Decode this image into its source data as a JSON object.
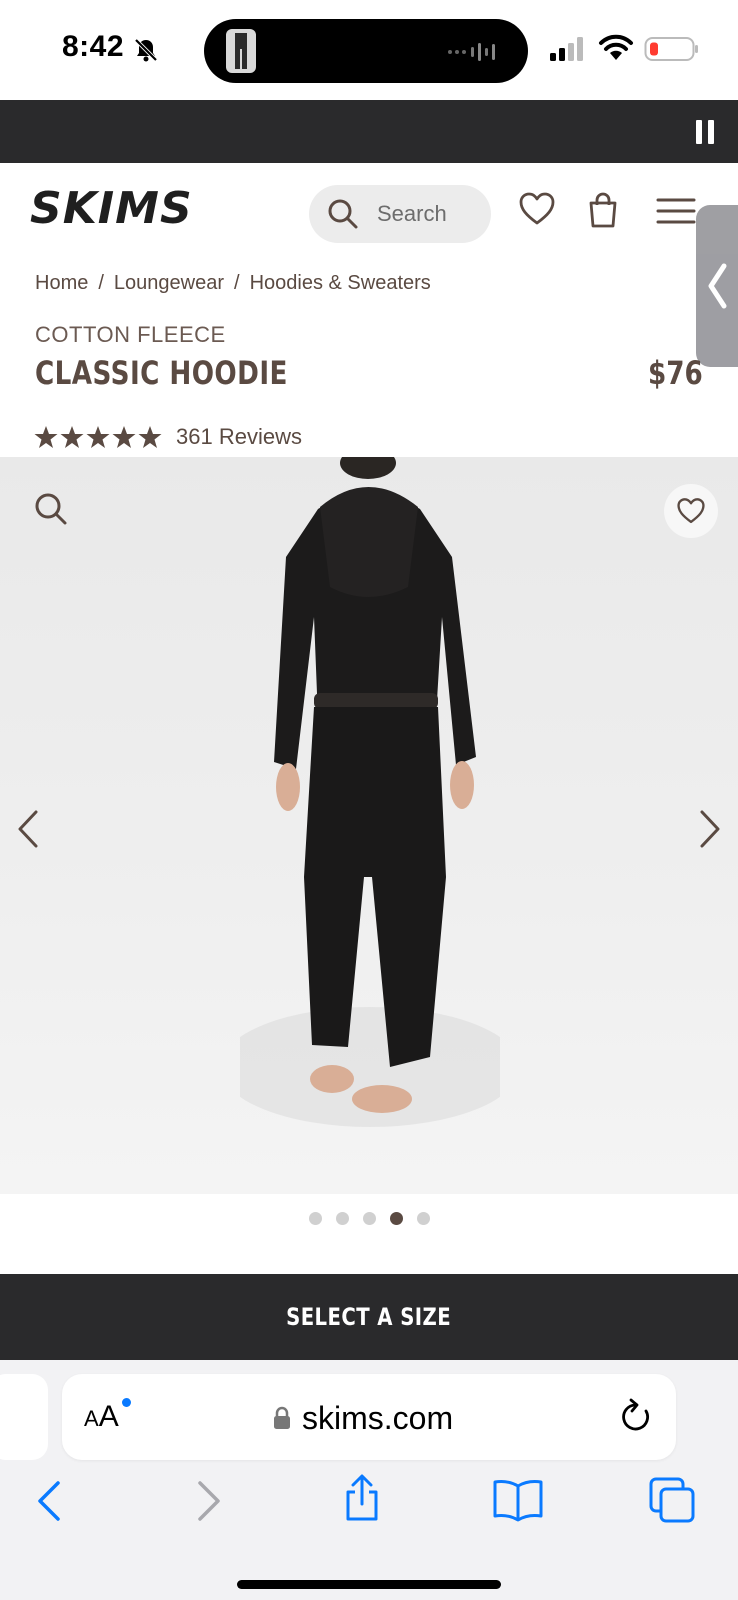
{
  "status": {
    "time": "8:42"
  },
  "header": {
    "search_placeholder": "Search"
  },
  "breadcrumb": {
    "items": [
      "Home",
      "Loungewear",
      "Hoodies & Sweaters"
    ],
    "separator": "/"
  },
  "product": {
    "collection": "COTTON FLEECE",
    "name": "CLASSIC HOODIE",
    "price": "$76",
    "rating": 5,
    "reviews": "361 Reviews"
  },
  "carousel": {
    "total": 5,
    "active_index": 3
  },
  "cta": {
    "label": "SELECT A SIZE"
  },
  "browser": {
    "aa_label_small": "A",
    "aa_label_large": "A",
    "url": "skims.com"
  },
  "colors": {
    "brand_brown": "#5a4a42",
    "dark_bar": "#2a2a2c",
    "ios_blue": "#0a7aff"
  }
}
